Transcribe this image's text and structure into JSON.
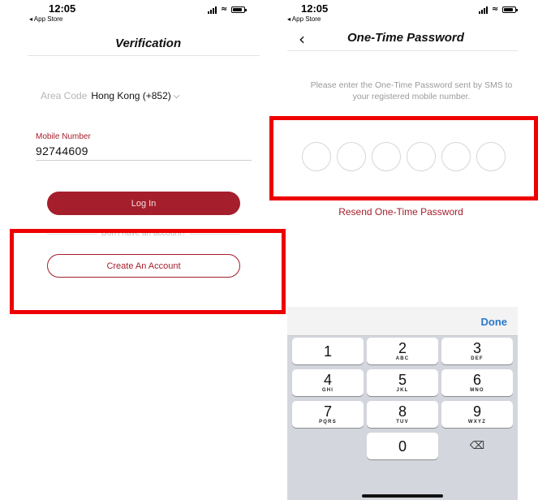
{
  "left_screen": {
    "status_bar": {
      "time": "12:05",
      "back_app": "◂ App Store"
    },
    "title": "Verification",
    "area_code": {
      "label": "Area Code",
      "value": "Hong Kong (+852)",
      "chevron": "⌵"
    },
    "mobile_number": {
      "label": "Mobile Number",
      "value": "92744609"
    },
    "login_label": "Log In",
    "no_account_text": "Don't have an account?",
    "create_account_label": "Create An Account"
  },
  "right_screen": {
    "status_bar": {
      "time": "12:05",
      "back_app": "◂ App Store"
    },
    "back_glyph": "‹",
    "title": "One-Time Password",
    "instructions_line1": "Please enter the One-Time Password sent by SMS to",
    "instructions_line2": "your registered mobile number.",
    "otp_digit_count": 6,
    "resend_label": "Resend One-Time Password",
    "keyboard": {
      "done_label": "Done",
      "keys": [
        {
          "digit": "1",
          "letters": ""
        },
        {
          "digit": "2",
          "letters": "ABC"
        },
        {
          "digit": "3",
          "letters": "DEF"
        },
        {
          "digit": "4",
          "letters": "GHI"
        },
        {
          "digit": "5",
          "letters": "JKL"
        },
        {
          "digit": "6",
          "letters": "MNO"
        },
        {
          "digit": "7",
          "letters": "PQRS"
        },
        {
          "digit": "8",
          "letters": "TUV"
        },
        {
          "digit": "9",
          "letters": "WXYZ"
        },
        {
          "digit": "0",
          "letters": ""
        }
      ],
      "delete_glyph": "⌫"
    }
  },
  "colors": {
    "brand_red": "#a51e2c",
    "highlight_red": "#ee0000",
    "done_blue": "#2a78c8"
  },
  "icons": [
    "signal-icon",
    "wifi-icon",
    "battery-icon",
    "chevron-down-icon",
    "back-chevron-icon",
    "delete-icon"
  ]
}
